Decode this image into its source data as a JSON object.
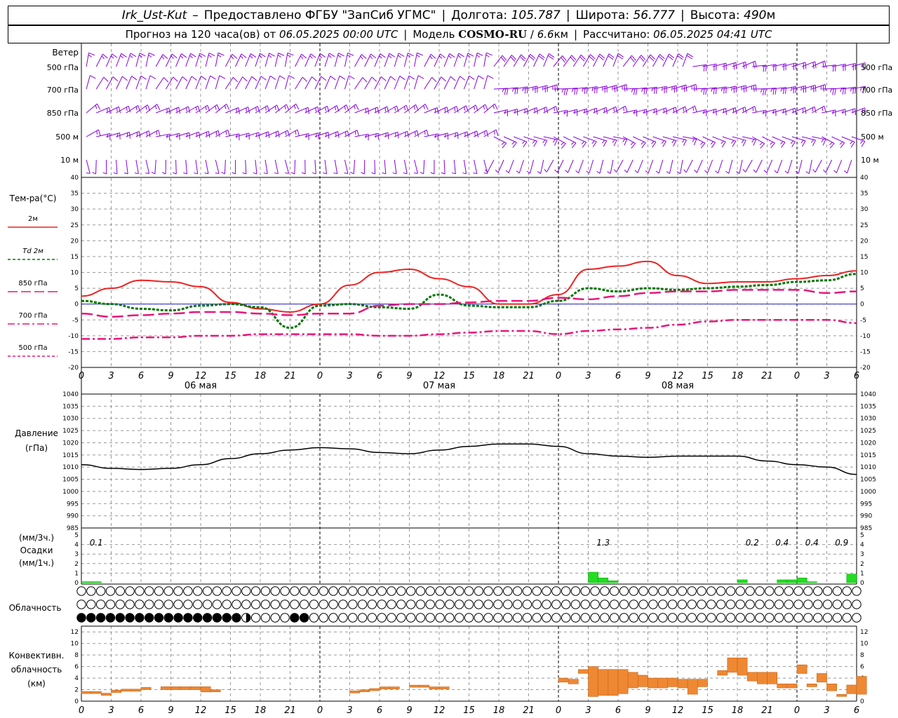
{
  "header": {
    "station": "Irk_Ust-Kut",
    "dash": "–",
    "provider": "Предоставлено ФГБУ \"ЗапСиб УГМС\"",
    "lon_label": "Долгота:",
    "lon": "105.787",
    "lat_label": "Широта:",
    "lat": "56.777",
    "alt_label": "Высота:",
    "alt": "490",
    "alt_unit": "м",
    "forecast_prefix": "Прогноз на 120 часа(ов) от",
    "init_time": "06.05.2025 00:00 UTC",
    "model_label": "Модель",
    "model": "COSMO-RU",
    "resolution": "6.6",
    "res_unit": "км",
    "calc_label": "Рассчитано:",
    "calc_time": "06.05.2025 04:41 UTC"
  },
  "wind_panel": {
    "title": "Ветер",
    "levels": [
      "500 гПа",
      "700 гПа",
      "850 гПа",
      "500 м",
      "10  м"
    ]
  },
  "temp_panel": {
    "title": "Тем-ра(°C)",
    "legend": [
      {
        "label": "2м",
        "color": "#ee2222",
        "dash": ""
      },
      {
        "label": "Td  2м",
        "color": "#007700",
        "dash": "4,3"
      },
      {
        "label": "850 гПа",
        "color": "#e8167a",
        "dash": "14,5"
      },
      {
        "label": "700 гПа",
        "color": "#e8167a",
        "dash": "10,4,3,4"
      },
      {
        "label": "500 гПа",
        "color": "#e8167a",
        "dash": "4,3"
      }
    ]
  },
  "pressure_panel": {
    "title": "Давление",
    "unit": "(гПа)"
  },
  "precip_panel": {
    "unit_3h": "(мм/3ч.)",
    "title": "Осадки",
    "unit_1h": "(мм/1ч.)"
  },
  "cloud_panel": {
    "title": "Облачность"
  },
  "conv_panel": {
    "title1": "Конвективн.",
    "title2": "облачность",
    "unit": "(км)"
  },
  "colors": {
    "wind": "#8800dd",
    "t2m": "#ee2222",
    "td": "#007700",
    "isobaric": "#e8167a",
    "zero_line": "#2222cc",
    "precip": "#22dd22",
    "conv": "#ee8833",
    "grid": "#999999"
  },
  "x_axis": {
    "hour_labels": [
      "0",
      "3",
      "6",
      "9",
      "12",
      "15",
      "18",
      "21",
      "0",
      "3",
      "6",
      "9",
      "12",
      "15",
      "18",
      "21",
      "0",
      "3",
      "6",
      "9",
      "12",
      "15",
      "18",
      "21",
      "0",
      "3",
      "6"
    ],
    "day_labels": [
      "06 мая",
      "07 мая",
      "08 мая"
    ]
  },
  "chart_data": [
    {
      "type": "line",
      "title": "Тем-ра(°C)",
      "ylim": [
        -20,
        40
      ],
      "ytick_labels": [
        "40",
        "35",
        "30",
        "25",
        "20",
        "15",
        "10",
        "5",
        "0",
        "-5",
        "-10",
        "-15",
        "-20"
      ],
      "x_hours": [
        0,
        3,
        6,
        9,
        12,
        15,
        18,
        21,
        24,
        27,
        30,
        33,
        36,
        39,
        42,
        45,
        48,
        51,
        54,
        57,
        60,
        63,
        66,
        69,
        72,
        75,
        78
      ],
      "series": [
        {
          "name": "2м",
          "values": [
            2.5,
            5,
            7.5,
            7,
            5.5,
            0.5,
            -1.5,
            -2.5,
            0,
            6,
            10,
            11,
            8,
            5.5,
            0,
            0,
            3,
            11,
            12,
            13.5,
            9,
            6.5,
            7,
            7,
            8,
            9,
            10.5
          ]
        },
        {
          "name": "Td 2м",
          "values": [
            1,
            0,
            -1.5,
            -2,
            -0.5,
            0,
            -1,
            -7.5,
            -0.5,
            0,
            -1,
            -1.5,
            3,
            -0.5,
            -1,
            -1,
            1,
            5,
            4,
            5,
            4.5,
            5,
            5.5,
            6,
            7,
            7.5,
            9.5
          ]
        },
        {
          "name": "850 гПа",
          "values": [
            -3,
            -4,
            -3.5,
            -3,
            -2.5,
            -2.5,
            -3,
            -3.5,
            -3,
            -3,
            -0.5,
            0,
            0,
            0.5,
            1,
            1,
            2,
            1.5,
            2.5,
            3.5,
            4,
            4,
            4.5,
            4.5,
            4.5,
            3.5,
            4
          ]
        },
        {
          "name": "700 гПа",
          "values": [
            -11,
            -11,
            -10.5,
            -10.5,
            -10,
            -10,
            -9.5,
            -9.5,
            -9.5,
            -9.5,
            -10,
            -10,
            -9.5,
            -9,
            -8.5,
            -8.5,
            -9.5,
            -8.5,
            -8,
            -7.5,
            -6.5,
            -5.5,
            -5,
            -5,
            -5,
            -5,
            -6
          ]
        }
      ]
    },
    {
      "type": "line",
      "title": "Давление",
      "ylabel": "(гПа)",
      "ylim": [
        985,
        1040
      ],
      "ytick_labels": [
        "1040",
        "1035",
        "1030",
        "1025",
        "1020",
        "1015",
        "1010",
        "1005",
        "1000",
        "995",
        "990",
        "985"
      ],
      "x_hours": [
        0,
        3,
        6,
        9,
        12,
        15,
        18,
        21,
        24,
        27,
        30,
        33,
        36,
        39,
        42,
        45,
        48,
        51,
        54,
        57,
        60,
        63,
        66,
        69,
        72,
        75,
        78
      ],
      "series": [
        {
          "name": "",
          "values": [
            1011,
            1009.5,
            1009,
            1009.5,
            1011,
            1013.5,
            1015.5,
            1017,
            1018,
            1017.5,
            1016,
            1015.5,
            1017,
            1018.5,
            1019.5,
            1019.5,
            1018.5,
            1015.5,
            1014.5,
            1014,
            1014.5,
            1014.5,
            1014.5,
            1012.5,
            1011,
            1010,
            1007
          ]
        }
      ]
    },
    {
      "type": "bar",
      "title": "Осадки",
      "ylabel": "(мм/1ч.)",
      "ylim": [
        0,
        5
      ],
      "ytick_labels": [
        "5",
        "4",
        "3",
        "2",
        "1",
        "0"
      ],
      "hourly": [
        {
          "h": 0,
          "v": 0.1
        },
        {
          "h": 1,
          "v": 0.1
        },
        {
          "h": 51,
          "v": 1.1
        },
        {
          "h": 52,
          "v": 0.5
        },
        {
          "h": 53,
          "v": 0.2
        },
        {
          "h": 66,
          "v": 0.3
        },
        {
          "h": 70,
          "v": 0.3
        },
        {
          "h": 71,
          "v": 0.3
        },
        {
          "h": 72,
          "v": 0.5
        },
        {
          "h": 73,
          "v": 0.1
        },
        {
          "h": 77,
          "v": 0.9
        }
      ],
      "totals_3h": [
        {
          "h": 1.5,
          "label": "0.1"
        },
        {
          "h": 52.5,
          "label": "1.3"
        },
        {
          "h": 67.5,
          "label": "0.2"
        },
        {
          "h": 70.5,
          "label": "0.4"
        },
        {
          "h": 73.5,
          "label": "0.4"
        },
        {
          "h": 76.5,
          "label": "0.9"
        }
      ]
    },
    {
      "type": "table",
      "title": "Облачность",
      "rows_note": "three layers, octas 0-8 per hour",
      "rows": [
        [
          0,
          0,
          0,
          0,
          0,
          0,
          0,
          0,
          0,
          0,
          0,
          0,
          0,
          0,
          0,
          0,
          0,
          0,
          0,
          0,
          0,
          0,
          0,
          0,
          0,
          0,
          0,
          0,
          0,
          0,
          0,
          0,
          0,
          0,
          0,
          0,
          0,
          0,
          0,
          0,
          0,
          0,
          0,
          0,
          0,
          0,
          0,
          0,
          0,
          0,
          0,
          0,
          0,
          0,
          0,
          0,
          0,
          0,
          0,
          0,
          0,
          0,
          0,
          0,
          0,
          0,
          0,
          0,
          0,
          0,
          0,
          0,
          0,
          0,
          0,
          0,
          0,
          0,
          0,
          0,
          0
        ],
        [
          0,
          0,
          0,
          0,
          0,
          0,
          0,
          0,
          0,
          0,
          0,
          0,
          0,
          0,
          0,
          0,
          0,
          0,
          0,
          0,
          0,
          0,
          0,
          0,
          0,
          0,
          0,
          0,
          0,
          0,
          0,
          0,
          0,
          0,
          0,
          0,
          0,
          0,
          0,
          0,
          0,
          0,
          0,
          0,
          0,
          0,
          0,
          0,
          0,
          0,
          0,
          0,
          0,
          0,
          0,
          0,
          0,
          0,
          0,
          0,
          0,
          0,
          0,
          0,
          0,
          0,
          0,
          0,
          0,
          0,
          0,
          0,
          0,
          0,
          0,
          0,
          0,
          0,
          0,
          0,
          0
        ],
        [
          8,
          8,
          8,
          8,
          8,
          8,
          8,
          8,
          8,
          8,
          8,
          8,
          8,
          8,
          8,
          8,
          8,
          4,
          0,
          0,
          0,
          0,
          8,
          8,
          0,
          0,
          0,
          0,
          0,
          0,
          0,
          0,
          0,
          0,
          0,
          0,
          0,
          0,
          0,
          0,
          0,
          0,
          0,
          0,
          0,
          0,
          0,
          0,
          0,
          0,
          0,
          0,
          0,
          0,
          0,
          0,
          0,
          0,
          0,
          0,
          0,
          0,
          0,
          0,
          0,
          0,
          0,
          0,
          0,
          0,
          0,
          0,
          0,
          0,
          0,
          0,
          0,
          0,
          0,
          0,
          0
        ]
      ]
    },
    {
      "type": "bar",
      "title": "Конвективн. облачность",
      "ylabel": "(км)",
      "ylim": [
        0,
        13
      ],
      "ytick_labels": [
        "12",
        "10",
        "8",
        "6",
        "4",
        "2",
        "0"
      ],
      "segments": [
        {
          "h": 0,
          "base": 1.5,
          "top": 1.5
        },
        {
          "h": 1,
          "base": 1.5,
          "top": 1.5
        },
        {
          "h": 2,
          "base": 1.2,
          "top": 1.2
        },
        {
          "h": 3,
          "base": 1.5,
          "top": 1.9
        },
        {
          "h": 4,
          "base": 1.9,
          "top": 1.9
        },
        {
          "h": 5,
          "base": 1.9,
          "top": 1.9
        },
        {
          "h": 6,
          "base": 2.2,
          "top": 2.2
        },
        {
          "h": 8,
          "base": 2.0,
          "top": 2.5
        },
        {
          "h": 9,
          "base": 2.0,
          "top": 2.5
        },
        {
          "h": 10,
          "base": 2.0,
          "top": 2.5
        },
        {
          "h": 11,
          "base": 2.0,
          "top": 2.5
        },
        {
          "h": 12,
          "base": 1.6,
          "top": 2.5
        },
        {
          "h": 13,
          "base": 1.8,
          "top": 1.8
        },
        {
          "h": 27,
          "base": 1.6,
          "top": 1.6
        },
        {
          "h": 28,
          "base": 1.8,
          "top": 1.8
        },
        {
          "h": 29,
          "base": 2.0,
          "top": 2.0
        },
        {
          "h": 30,
          "base": 2.3,
          "top": 2.3
        },
        {
          "h": 31,
          "base": 2.3,
          "top": 2.3
        },
        {
          "h": 33,
          "base": 2.6,
          "top": 2.6
        },
        {
          "h": 34,
          "base": 2.6,
          "top": 2.6
        },
        {
          "h": 35,
          "base": 2.3,
          "top": 2.3
        },
        {
          "h": 36,
          "base": 2.3,
          "top": 2.3
        },
        {
          "h": 48,
          "base": 3.3,
          "top": 4.0
        },
        {
          "h": 49,
          "base": 3.0,
          "top": 3.8
        },
        {
          "h": 50,
          "base": 5.0,
          "top": 5.3
        },
        {
          "h": 51,
          "base": 0.8,
          "top": 6.0
        },
        {
          "h": 52,
          "base": 1.0,
          "top": 5.5
        },
        {
          "h": 53,
          "base": 1.0,
          "top": 5.5
        },
        {
          "h": 54,
          "base": 1.3,
          "top": 5.5
        },
        {
          "h": 55,
          "base": 2.3,
          "top": 5.0
        },
        {
          "h": 56,
          "base": 2.5,
          "top": 4.5
        },
        {
          "h": 57,
          "base": 2.3,
          "top": 4.0
        },
        {
          "h": 58,
          "base": 2.3,
          "top": 4.0
        },
        {
          "h": 59,
          "base": 2.5,
          "top": 4.0
        },
        {
          "h": 60,
          "base": 2.3,
          "top": 3.8
        },
        {
          "h": 61,
          "base": 1.2,
          "top": 3.8
        },
        {
          "h": 62,
          "base": 2.5,
          "top": 3.8
        },
        {
          "h": 64,
          "base": 4.5,
          "top": 5.3
        },
        {
          "h": 65,
          "base": 5.0,
          "top": 7.5
        },
        {
          "h": 66,
          "base": 4.5,
          "top": 7.5
        },
        {
          "h": 67,
          "base": 3.5,
          "top": 5.0
        },
        {
          "h": 68,
          "base": 3.0,
          "top": 5.0
        },
        {
          "h": 69,
          "base": 3.0,
          "top": 5.0
        },
        {
          "h": 70,
          "base": 2.3,
          "top": 3.0
        },
        {
          "h": 71,
          "base": 2.3,
          "top": 3.0
        },
        {
          "h": 72,
          "base": 4.8,
          "top": 6.3
        },
        {
          "h": 73,
          "base": 2.5,
          "top": 3.0
        },
        {
          "h": 74,
          "base": 3.3,
          "top": 4.8
        },
        {
          "h": 75,
          "base": 1.8,
          "top": 3.0
        },
        {
          "h": 76,
          "base": 1.0,
          "top": 1.0
        },
        {
          "h": 77,
          "base": 1.3,
          "top": 2.8
        },
        {
          "h": 78,
          "base": 1.2,
          "top": 4.3
        }
      ]
    }
  ]
}
